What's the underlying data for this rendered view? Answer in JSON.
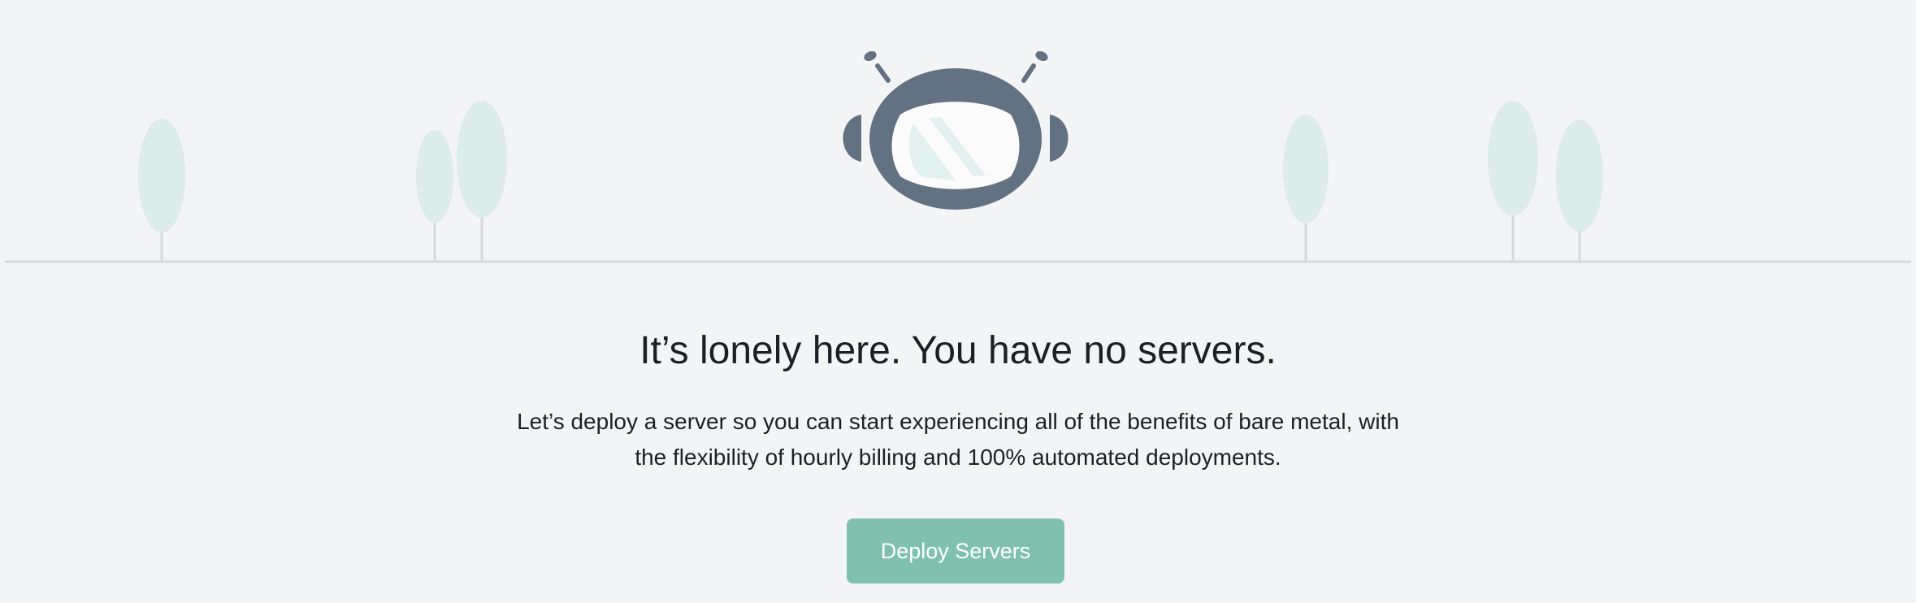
{
  "empty_state": {
    "headline": "It’s lonely here. You have no servers.",
    "description": "Let’s deploy a server so you can start experiencing all of the benefits of bare metal, with the flexibility of hourly billing and 100% automated deployments.",
    "primary_action_label": "Deploy Servers"
  },
  "illustration": {
    "icon": "robot-icon",
    "colors": {
      "robot": "#637283",
      "visor": "#fbfbfb",
      "glare": "#e2f1f0",
      "tree": "#dcece8",
      "ground": "#d6d9dc",
      "accent": "#80c1ae"
    }
  }
}
